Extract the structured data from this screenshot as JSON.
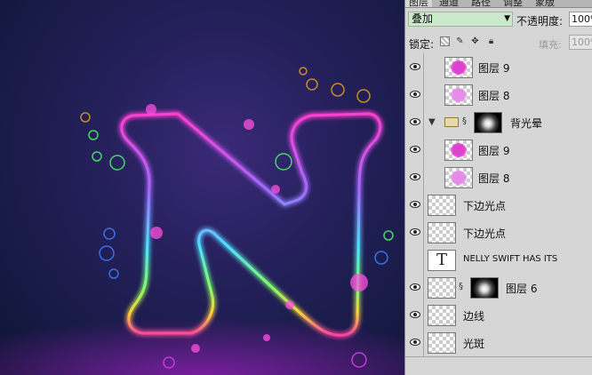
{
  "panel": {
    "tabs": [
      "图层",
      "通道",
      "路径",
      "调整",
      "蒙版"
    ],
    "blend_mode": "叠加",
    "opacity_label": "不透明度:",
    "opacity_value": "100%",
    "lock_label": "锁定:",
    "fill_label": "填充:",
    "fill_value": "100%"
  },
  "layers": [
    {
      "name": "图层 9",
      "visible": true,
      "indent": true,
      "thumb": "pink-blob"
    },
    {
      "name": "图层 8",
      "visible": true,
      "indent": true,
      "thumb": "light-pink-blob"
    },
    {
      "name": "背光晕",
      "visible": true,
      "group": true,
      "expanded": true,
      "thumb": "mask"
    },
    {
      "name": "图层 9",
      "visible": true,
      "indent": true,
      "thumb": "pink-blob"
    },
    {
      "name": "图层 8",
      "visible": true,
      "indent": true,
      "thumb": "light-pink-blob"
    },
    {
      "name": "下边光点",
      "visible": true,
      "thumb": "transparent"
    },
    {
      "name": "下边光点",
      "visible": true,
      "thumb": "transparent"
    },
    {
      "name": "NELLY SWIFT HAS ITS",
      "visible": false,
      "thumb": "text"
    },
    {
      "name": "图层 6",
      "visible": true,
      "thumb": "masked"
    },
    {
      "name": "边线",
      "visible": true,
      "thumb": "transparent"
    },
    {
      "name": "光斑",
      "visible": true,
      "thumb": "transparent"
    }
  ],
  "colors": {
    "pink_blob": "#e040d0",
    "light_pink_blob": "#e58be8",
    "blend_bg": "#cbeacc"
  },
  "icons": {
    "eye": "eye-icon",
    "lock_transparent": "checkerboard-lock-icon",
    "lock_brush": "brush-lock-icon",
    "lock_move": "move-lock-icon",
    "lock_all": "padlock-icon",
    "chain": "link-icon",
    "folder": "folder-icon"
  }
}
